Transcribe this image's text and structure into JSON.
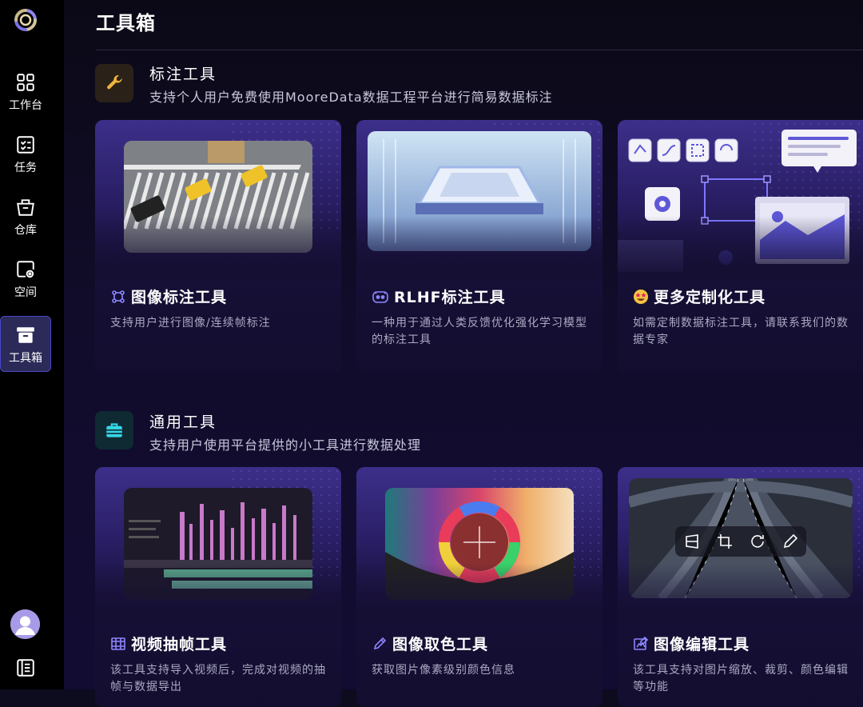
{
  "sidebar": {
    "items": [
      {
        "label": "工作台",
        "icon": "grid-icon"
      },
      {
        "label": "任务",
        "icon": "checklist-icon"
      },
      {
        "label": "仓库",
        "icon": "basket-icon"
      },
      {
        "label": "空间",
        "icon": "space-icon"
      },
      {
        "label": "工具箱",
        "icon": "toolbox-icon",
        "active": true
      }
    ],
    "collapse_glyph": "»"
  },
  "page": {
    "title": "工具箱"
  },
  "sections": [
    {
      "title": "标注工具",
      "subtitle": "支持个人用户免费使用MooreData数据工程平台进行简易数据标注",
      "icon": "wrench-icon",
      "cards": [
        {
          "title": "图像标注工具",
          "desc": "支持用户进行图像/连续帧标注",
          "icon": "bounding-box-icon"
        },
        {
          "title": "RLHF标注工具",
          "desc": "一种用于通过人类反馈优化强化学习模型的标注工具",
          "icon": "robot-icon"
        },
        {
          "title": "更多定制化工具",
          "desc": "如需定制数据标注工具，请联系我们的数据专家",
          "icon": "star-eyes-emoji-icon"
        }
      ]
    },
    {
      "title": "通用工具",
      "subtitle": "支持用户使用平台提供的小工具进行数据处理",
      "icon": "briefcase-icon",
      "cards": [
        {
          "title": "视频抽帧工具",
          "desc": "该工具支持导入视频后，完成对视频的抽帧与数据导出",
          "icon": "film-icon"
        },
        {
          "title": "图像取色工具",
          "desc": "获取图片像素级别颜色信息",
          "icon": "eyedropper-icon"
        },
        {
          "title": "图像编辑工具",
          "desc": "该工具支持对图片缩放、裁剪、颜色编辑等功能",
          "icon": "edit-image-icon"
        }
      ]
    }
  ],
  "colors": {
    "accent": "#4a47c8",
    "wrench": "#f0b33c",
    "briefcase": "#35d6e6"
  }
}
